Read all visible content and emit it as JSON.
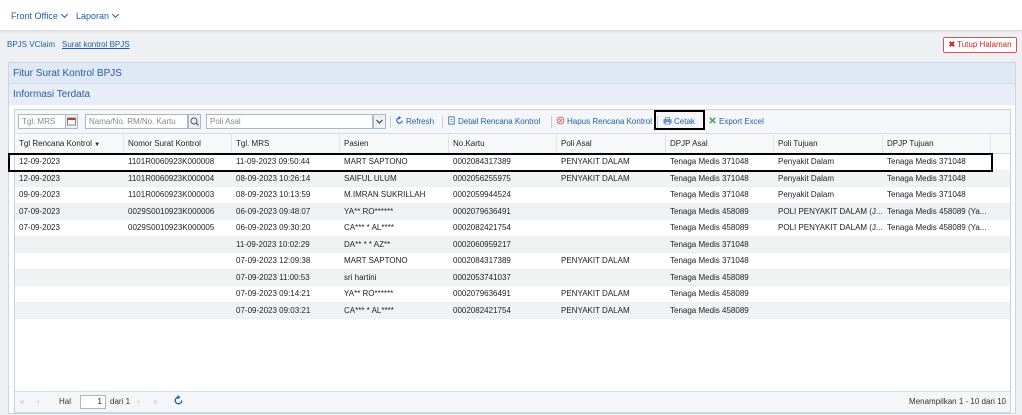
{
  "menu": [
    {
      "label": "Front Office"
    },
    {
      "label": "Laporan"
    }
  ],
  "breadcrumb": {
    "parent": "BPJS VClaim",
    "current": "Surat kontrol BPJS"
  },
  "close_button": {
    "label": "Tutup Halaman"
  },
  "panel": {
    "title": "Fitur Surat Kontrol BPJS",
    "subtitle": "Informasi Terdata"
  },
  "toolbar": {
    "date_placeholder": "Tgl. MRS",
    "search_placeholder": "Nama/No. RM/No. Kartu",
    "poli_placeholder": "Poli Asal",
    "refresh": "Refresh",
    "detail": "Detail Rencana Kontrol",
    "hapus": "Hapus Rencana Kontrol",
    "cetak": "Cetak",
    "export": "Export Excel"
  },
  "columns": [
    "Tgl Rencana Kontrol",
    "Nomor Surat Kontrol",
    "Tgl. MRS",
    "Pasien",
    "No.Kartu",
    "Poli Asal",
    "DPJP Asal",
    "Poli Tujuan",
    "DPJP Tujuan"
  ],
  "rows": [
    [
      "12-09-2023",
      "1101R0060923K000008",
      "11-09-2023 09:50:44",
      "MART SAPTONO",
      "0002084317389",
      "PENYAKIT DALAM",
      "Tenaga Medis 371048",
      "Penyakit Dalam",
      "Tenaga Medis 371048"
    ],
    [
      "12-09-2023",
      "1101R0060923K000004",
      "08-09-2023 10:26:14",
      "SAIFUL ULUM",
      "0002056255975",
      "PENYAKIT DALAM",
      "Tenaga Medis 371048",
      "Penyakit Dalam",
      "Tenaga Medis 371048"
    ],
    [
      "09-09-2023",
      "1101R0060923K000003",
      "08-09-2023 10:13:59",
      "M.IMRAN SUKRILLAH",
      "0002059944524",
      "",
      "Tenaga Medis 371048",
      "Penyakit Dalam",
      "Tenaga Medis 371048"
    ],
    [
      "07-09-2023",
      "0029S0010923K000006",
      "06-09-2023 09:48:07",
      "YA** RO******",
      "0002079636491",
      "",
      "Tenaga Medis 458089",
      "POLI PENYAKIT DALAM (J...",
      "Tenaga Medis 458089 (Ya..."
    ],
    [
      "07-09-2023",
      "0029S0010923K000005",
      "06-09-2023 09:30:20",
      "CA*** * AL****",
      "0002082421754",
      "",
      "Tenaga Medis 458089",
      "POLI PENYAKIT DALAM (J...",
      "Tenaga Medis 458089 (Ya..."
    ],
    [
      "",
      "",
      "11-09-2023 10:02:29",
      "DA** * * AZ**",
      "0002060959217",
      "",
      "Tenaga Medis 371048",
      "",
      ""
    ],
    [
      "",
      "",
      "07-09-2023 12:09:38",
      "MART SAPTONO",
      "0002084317389",
      "PENYAKIT DALAM",
      "Tenaga Medis 371048",
      "",
      ""
    ],
    [
      "",
      "",
      "07-09-2023 11:00:53",
      "sri hartini",
      "0002053741037",
      "",
      "Tenaga Medis 458089",
      "",
      ""
    ],
    [
      "",
      "",
      "07-09-2023 09:14:21",
      "YA** RO******",
      "0002079636491",
      "PENYAKIT DALAM",
      "Tenaga Medis 458089",
      "",
      ""
    ],
    [
      "",
      "",
      "07-09-2023 09:03:21",
      "CA*** * AL****",
      "0002082421754",
      "PENYAKIT DALAM",
      "Tenaga Medis 458089",
      "",
      ""
    ]
  ],
  "pager": {
    "hal": "Hal",
    "page": "1",
    "of": "dari 1",
    "summary": "Menampilkan 1 - 10 dari 10"
  },
  "colors": {
    "accent": "#1f5fa8",
    "panel_header": "#dfe8f5",
    "danger": "#c62828"
  }
}
